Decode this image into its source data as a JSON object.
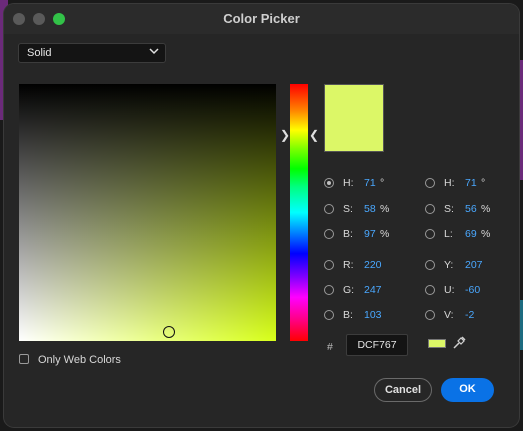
{
  "window": {
    "title": "Color Picker"
  },
  "fill_type": {
    "selected": "Solid"
  },
  "current_color": "#DCF767",
  "hue_base_color": "#d8ff1a",
  "fields_left": [
    {
      "label": "H:",
      "value": "71",
      "unit": "°",
      "selected": true
    },
    {
      "label": "S:",
      "value": "58",
      "unit": "%",
      "selected": false
    },
    {
      "label": "B:",
      "value": "97",
      "unit": "%",
      "selected": false
    },
    {
      "label": "R:",
      "value": "220",
      "unit": "",
      "selected": false
    },
    {
      "label": "G:",
      "value": "247",
      "unit": "",
      "selected": false
    },
    {
      "label": "B:",
      "value": "103",
      "unit": "",
      "selected": false
    }
  ],
  "fields_right": [
    {
      "label": "H:",
      "value": "71",
      "unit": "°",
      "selected": false
    },
    {
      "label": "S:",
      "value": "56",
      "unit": "%",
      "selected": false
    },
    {
      "label": "L:",
      "value": "69",
      "unit": "%",
      "selected": false
    },
    {
      "label": "Y:",
      "value": "207",
      "unit": "",
      "selected": false
    },
    {
      "label": "U:",
      "value": "-60",
      "unit": "",
      "selected": false
    },
    {
      "label": "V:",
      "value": "-2",
      "unit": "",
      "selected": false
    }
  ],
  "hex": {
    "prefix": "#",
    "value": "DCF767"
  },
  "web_colors": {
    "label": "Only Web Colors",
    "checked": false
  },
  "buttons": {
    "cancel": "Cancel",
    "ok": "OK"
  },
  "icons": {
    "dropdown": "chevron-down-icon",
    "eyedropper": "eyedropper-icon",
    "hue_left": "chevron-right-icon",
    "hue_right": "chevron-left-icon"
  }
}
